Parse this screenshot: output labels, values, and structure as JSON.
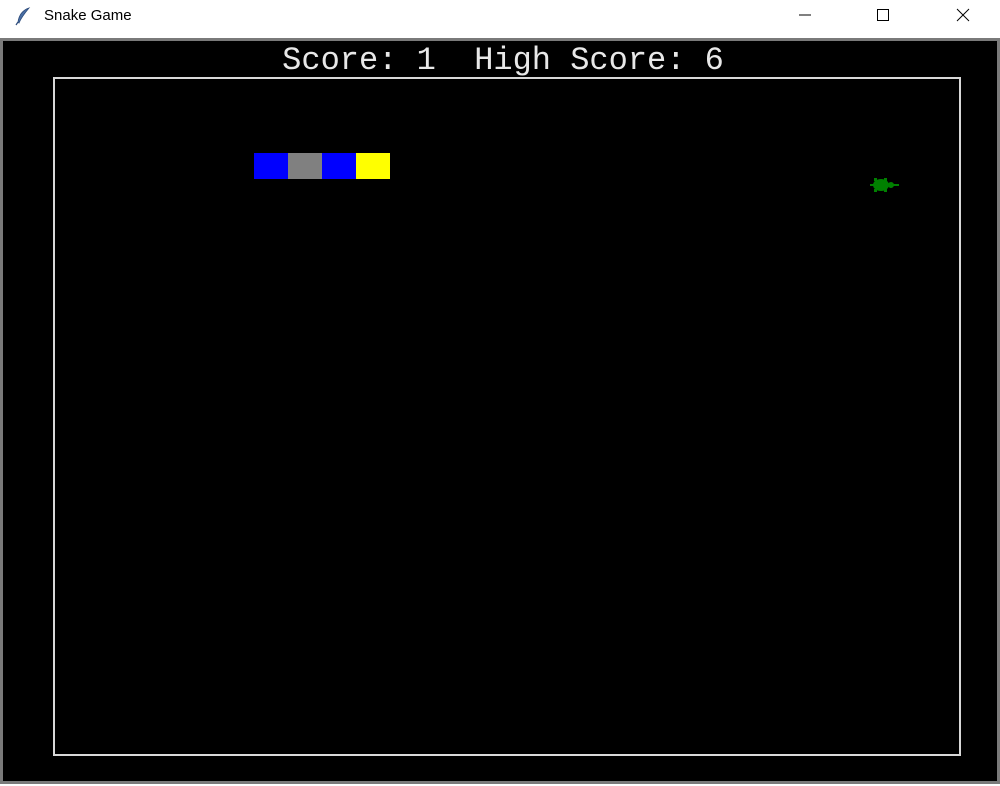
{
  "window": {
    "title": "Snake Game",
    "icon": "feather-icon",
    "controls": [
      "minimize-icon",
      "maximize-icon",
      "close-icon"
    ]
  },
  "scoreboard": {
    "score_label": "Score:",
    "score": 1,
    "high_score_label": "High Score:",
    "high_score": 6
  },
  "snake": {
    "segments": [
      {
        "role": "body",
        "color": "#0000ff"
      },
      {
        "role": "body",
        "color": "#808080"
      },
      {
        "role": "body",
        "color": "#0000ff"
      },
      {
        "role": "head",
        "color": "#ffff00"
      }
    ]
  },
  "food": {
    "icon": "turtle-icon",
    "color": "#008000"
  },
  "colors": {
    "background": "#000000",
    "border": "#d8d8d8",
    "text": "#e8e8e8"
  }
}
